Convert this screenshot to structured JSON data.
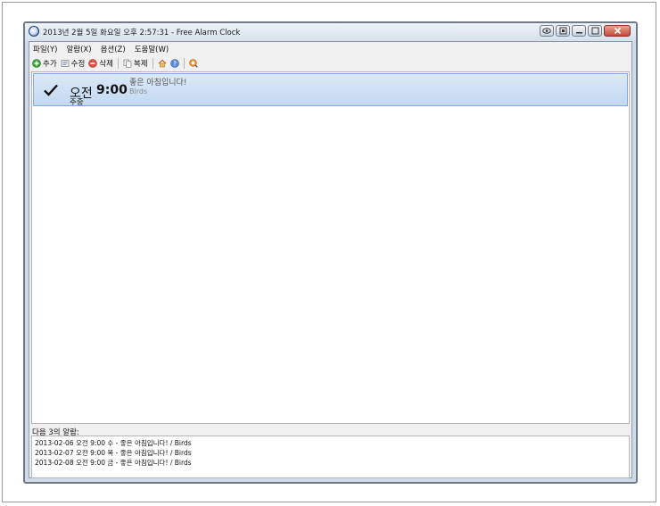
{
  "window": {
    "title": "2013년 2월 5일 화요일 오후 2:57:31 - Free Alarm Clock"
  },
  "menu": [
    "파일(Y)",
    "알람(X)",
    "옵션(Z)",
    "도움말(W)"
  ],
  "toolbar": {
    "add": "추가",
    "edit": "수정",
    "delete": "삭제",
    "copy": "복제"
  },
  "alarms": [
    {
      "ampm": "오전",
      "time": "9:00",
      "repeat": "주중",
      "message": "좋은 아침입니다!",
      "sound": "Birds",
      "enabled": true
    }
  ],
  "next": {
    "label": "다음 3의 알람:",
    "items": [
      "2013-02-06 오전 9:00 수 - 좋은 아침입니다! / Birds",
      "2013-02-07 오전 9:00 목 - 좋은 아침입니다! / Birds",
      "2013-02-08 오전 9:00 금 - 좋은 아침입니다! / Birds"
    ]
  },
  "colors": {
    "selection": "#c9ddf3",
    "selection_border": "#84acdd",
    "close_button": "#c4493a"
  }
}
